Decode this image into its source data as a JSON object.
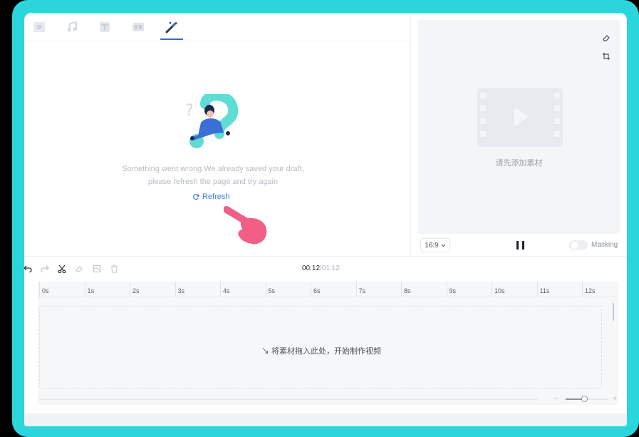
{
  "tabs": [
    {
      "name": "media-tab",
      "icon": "media-icon",
      "active": false
    },
    {
      "name": "audio-tab",
      "icon": "music-note-icon",
      "active": false
    },
    {
      "name": "text-tab",
      "icon": "text-icon",
      "active": false
    },
    {
      "name": "transition-tab",
      "icon": "transition-icon",
      "active": false
    },
    {
      "name": "effects-tab",
      "icon": "magic-wand-icon",
      "active": true
    }
  ],
  "error": {
    "line1": "Something went wrong.We already saved your draft,",
    "line2": "please refresh the page and try again",
    "refresh_label": "Refresh"
  },
  "preview": {
    "empty_text": "请先添加素材",
    "ratio": "16:9",
    "masking_label": "Masking",
    "masking_enabled": false
  },
  "toolbar": {
    "current_time": "00:12",
    "total_time": "/01:12"
  },
  "ruler": [
    "0s",
    "1s",
    "2s",
    "3s",
    "4s",
    "5s",
    "6s",
    "7s",
    "8s",
    "9s",
    "10s",
    "11s",
    "12s"
  ],
  "timeline": {
    "drop_text": "↘ 将素材拖入此处，开始制作视频",
    "zoom_level": 0.45
  },
  "colors": {
    "accent": "#3f7fd9",
    "frame": "#2ad6dc",
    "illustration": "#5fdcd4",
    "hand": "#f25f86"
  }
}
